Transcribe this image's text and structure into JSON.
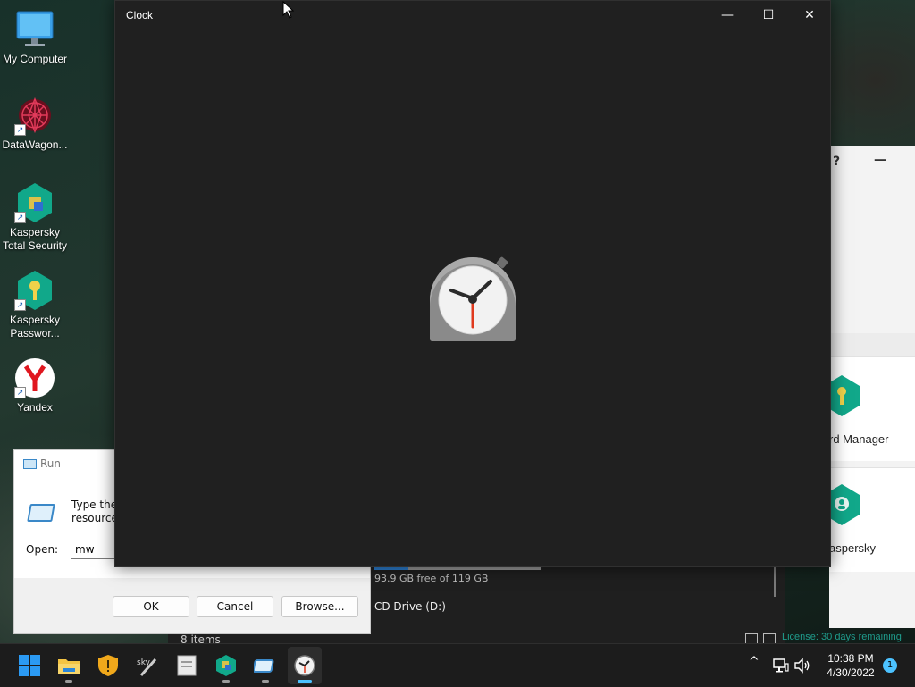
{
  "desktop": {
    "icons": [
      {
        "label": "My Computer"
      },
      {
        "label": "DataWagon..."
      },
      {
        "label": "Kaspersky Total Security"
      },
      {
        "label": "Kaspersky Passwor..."
      },
      {
        "label": "Yandex"
      }
    ]
  },
  "clock_window": {
    "title": "Clock",
    "minimize": "—",
    "maximize": "☐",
    "close": "✕"
  },
  "kaspersky_window": {
    "help": "?",
    "minimize": "—",
    "card1_label": "rd Manager",
    "card2_label": "aspersky",
    "license": "License: 30 days remaining"
  },
  "explorer": {
    "drive_free": "93.9 GB free of 119 GB",
    "drive_used_fraction": 0.21,
    "cd_drive": "CD Drive (D:)",
    "status_items": "8 items"
  },
  "run_dialog": {
    "title": "Run",
    "description_line1": "Type the n",
    "description_line2": "resource, a",
    "open_label": "Open:",
    "open_value": "mw",
    "ok_label": "OK",
    "cancel_label": "Cancel",
    "browse_label": "Browse..."
  },
  "taskbar": {
    "time": "10:38 PM",
    "date": "4/30/2022",
    "notification_count": "1",
    "tray_chevron": "^"
  },
  "colors": {
    "clock_bg": "#202020",
    "accent": "#4cc2ff",
    "kaspersky_teal": "#1f9c8c"
  }
}
